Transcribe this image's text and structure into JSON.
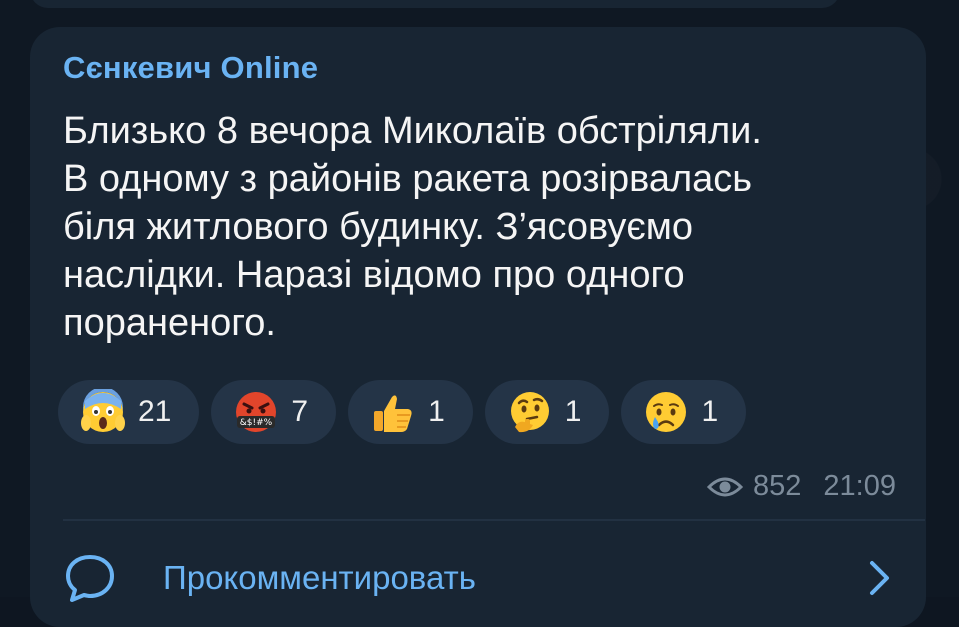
{
  "message": {
    "sender": "Сєнкевич Online",
    "text": "Близько 8 вечора Миколаїв обстріляли.\nВ одному з районів ракета розірвалась\nбіля житлового будинку. З’ясовуємо\nнаслідки. Наразі відомо про одного\nпораненого.",
    "views": "852",
    "time": "21:09"
  },
  "reactions": [
    {
      "icon": "face-screaming-in-fear-icon",
      "count": "21"
    },
    {
      "icon": "face-with-symbols-on-mouth-icon",
      "count": "7"
    },
    {
      "icon": "thumbs-up-icon",
      "count": "1"
    },
    {
      "icon": "thinking-face-icon",
      "count": "1"
    },
    {
      "icon": "crying-face-icon",
      "count": "1"
    }
  ],
  "comments": {
    "label": "Прокомментировать"
  },
  "colors": {
    "background": "#0f1823",
    "bubble": "#182533",
    "accent": "#6ab3f3",
    "text": "#f5f5f5",
    "meta": "#7c8b9a",
    "reaction_bg": "#243447"
  }
}
